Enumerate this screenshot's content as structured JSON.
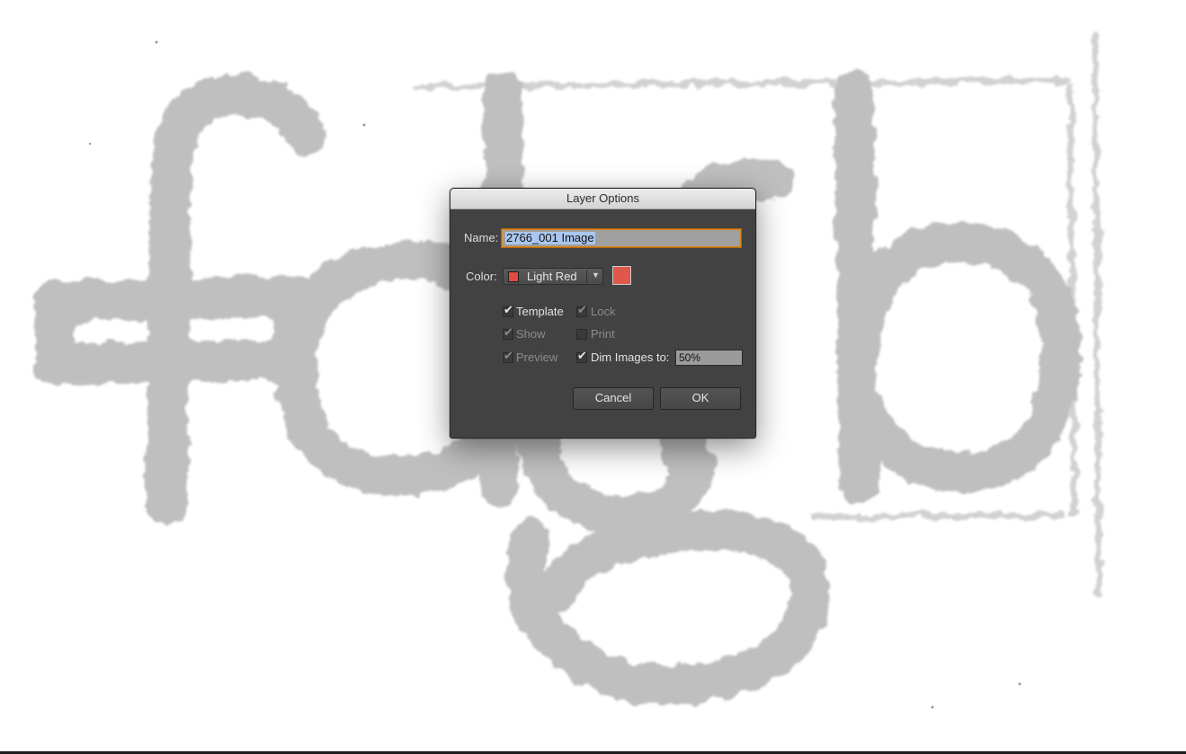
{
  "dialog": {
    "title": "Layer Options",
    "name_label": "Name:",
    "name_value": "2766_001 Image",
    "color_label": "Color:",
    "color_value": "Light Red",
    "color_hex": "#e05849",
    "checkboxes": {
      "template": {
        "label": "Template",
        "checked": true,
        "enabled": true
      },
      "lock": {
        "label": "Lock",
        "checked": true,
        "enabled": false
      },
      "show": {
        "label": "Show",
        "checked": true,
        "enabled": false
      },
      "print": {
        "label": "Print",
        "checked": false,
        "enabled": false
      },
      "preview": {
        "label": "Preview",
        "checked": true,
        "enabled": false
      },
      "dim_images": {
        "label": "Dim Images to:",
        "checked": true,
        "enabled": true
      }
    },
    "dim_value": "50%",
    "cancel_label": "Cancel",
    "ok_label": "OK"
  },
  "background": {
    "letters": "fdgb",
    "stroke_color": "#b4b4b4"
  },
  "colors": {
    "dialog_bg": "#424242",
    "focus_ring": "#d5871a",
    "selection": "#a9c7ef"
  }
}
